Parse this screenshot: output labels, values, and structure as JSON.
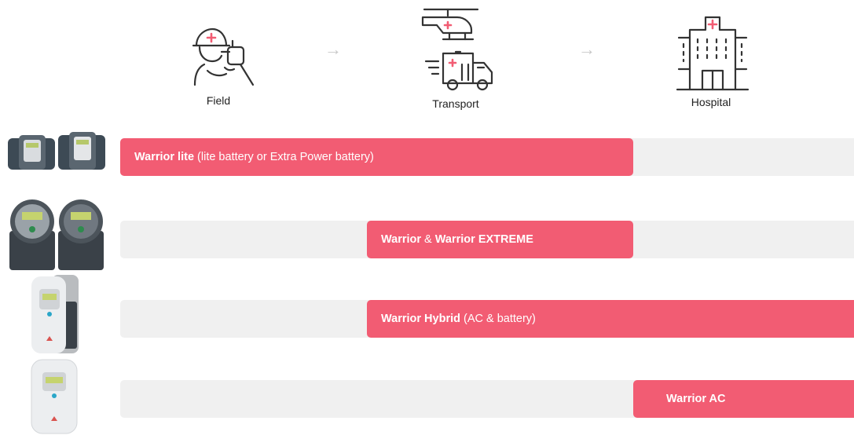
{
  "phases": [
    {
      "label": "Field",
      "icon": "field-responder-icon"
    },
    {
      "label": "Transport",
      "icon": "transport-helicopter-ambulance-icon"
    },
    {
      "label": "Hospital",
      "icon": "hospital-building-icon"
    }
  ],
  "arrow_glyph": "→",
  "colors": {
    "accent": "#f25c73",
    "track": "#f0f0f0",
    "icon_stroke": "#333333",
    "icon_red": "#f25c73",
    "arrow": "#c8c8c8"
  },
  "rows": [
    {
      "device_icon": "warrior-lite-device-icon",
      "bar_start_phase": "Field",
      "bar_end_phase": "Transport",
      "bold1": "Warrior lite",
      "text1": " (lite battery or Extra Power battery)",
      "bold2": "",
      "text2": ""
    },
    {
      "device_icon": "warrior-extreme-device-icon",
      "bar_start_phase": "Transport",
      "bar_end_phase": "Transport",
      "bold1": "Warrior",
      "text1": " & ",
      "bold2": "Warrior EXTREME",
      "text2": ""
    },
    {
      "device_icon": "warrior-hybrid-device-icon",
      "bar_start_phase": "Transport",
      "bar_end_phase": "Hospital",
      "bold1": "Warrior Hybrid",
      "text1": " (AC & battery)",
      "bold2": "",
      "text2": ""
    },
    {
      "device_icon": "warrior-ac-device-icon",
      "bar_start_phase": "Hospital",
      "bar_end_phase": "Hospital",
      "bold1": "Warrior AC",
      "text1": "",
      "bold2": "",
      "text2": ""
    }
  ]
}
